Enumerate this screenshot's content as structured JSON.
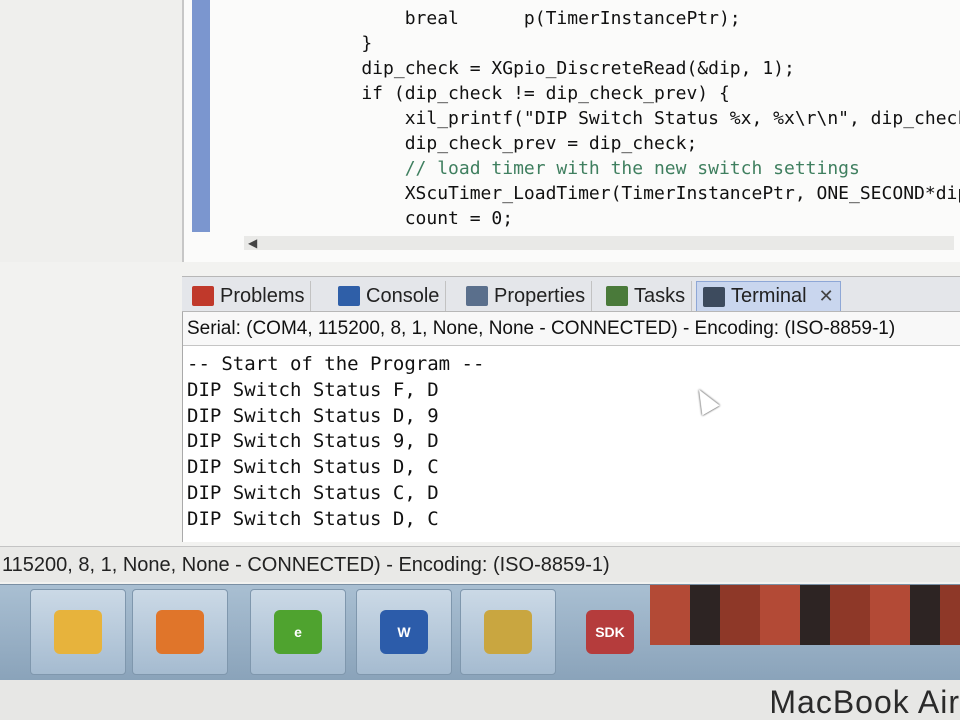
{
  "editor": {
    "code_lines": [
      {
        "text": "        breal      p(TimerInstancePtr);",
        "cls": ""
      },
      {
        "text": "    }",
        "cls": ""
      },
      {
        "text": "    dip_check = XGpio_DiscreteRead(&dip, 1);",
        "cls": ""
      },
      {
        "text": "    if (dip_check != dip_check_prev) {",
        "cls": ""
      },
      {
        "text": "        xil_printf(\"DIP Switch Status %x, %x\\r\\n\", dip_check_pre",
        "cls": ""
      },
      {
        "text": "        dip_check_prev = dip_check;",
        "cls": ""
      },
      {
        "text": "        // load timer with the new switch settings",
        "cls": "cmt"
      },
      {
        "text": "        XScuTimer_LoadTimer(TimerInstancePtr, ONE_SECOND*dip_che",
        "cls": ""
      },
      {
        "text": "        count = 0;",
        "cls": ""
      }
    ]
  },
  "tabs": [
    {
      "label": "Problems",
      "icon": "problems-icon",
      "color": "#c0392b"
    },
    {
      "label": "Console",
      "icon": "console-icon",
      "color": "#2f5fa8"
    },
    {
      "label": "Properties",
      "icon": "properties-icon",
      "color": "#5a6f8c"
    },
    {
      "label": "Tasks",
      "icon": "tasks-icon",
      "color": "#4a7a3a"
    },
    {
      "label": "Terminal",
      "icon": "terminal-icon",
      "color": "#3d4b5e"
    }
  ],
  "terminal": {
    "serial_status": "Serial: (COM4, 115200, 8, 1, None, None - CONNECTED) - Encoding: (ISO-8859-1)",
    "lines": [
      "-- Start of the Program --",
      "DIP Switch Status F, D",
      "DIP Switch Status D, 9",
      "DIP Switch Status 9, D",
      "DIP Switch Status D, C",
      "DIP Switch Status C, D",
      "DIP Switch Status D, C"
    ]
  },
  "statusbar": {
    "text": "115200, 8, 1, None, None - CONNECTED) - Encoding: (ISO-8859-1)"
  },
  "taskbar": {
    "apps": [
      {
        "name": "file-explorer-icon",
        "label": "",
        "color": "#e7b33c"
      },
      {
        "name": "media-player-icon",
        "label": "",
        "color": "#e0752a"
      },
      {
        "name": "ie-browser-icon",
        "label": "e",
        "color": "#4fa32f"
      },
      {
        "name": "word-icon",
        "label": "W",
        "color": "#2c5caa"
      },
      {
        "name": "vivado-icon",
        "label": "",
        "color": "#c9a640"
      },
      {
        "name": "sdk-icon",
        "label": "SDK",
        "color": "#b53c3c"
      }
    ]
  },
  "device": {
    "brand": "MacBook Air"
  }
}
